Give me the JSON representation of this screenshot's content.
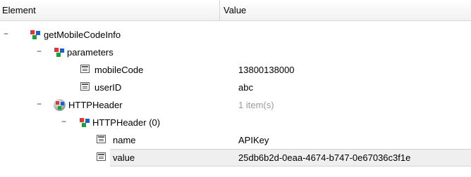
{
  "header": {
    "element": "Element",
    "value": "Value"
  },
  "tree": {
    "root": {
      "label": "getMobileCodeInfo",
      "toggle": "−"
    },
    "parameters": {
      "label": "parameters",
      "toggle": "−"
    },
    "mobileCode": {
      "label": "mobileCode",
      "value": "13800138000"
    },
    "userID": {
      "label": "userID",
      "value": "abc"
    },
    "httpHeader": {
      "label": "HTTPHeader",
      "value": "1 item(s)",
      "toggle": "−"
    },
    "httpHeader0": {
      "label": "HTTPHeader (0)",
      "toggle": "−"
    },
    "name": {
      "label": "name",
      "value": "APIKey"
    },
    "value": {
      "label": "value",
      "value": "25db6b2d-0eaa-4674-b747-0e67036c3f1e"
    }
  },
  "icons": {
    "tree_node": "tree-node-icon",
    "http_header": "http-header-icon",
    "field": "field-icon"
  },
  "colors": {
    "red": "#e8322b",
    "blue": "#1f5fd4",
    "green": "#19a23b",
    "selected_row": "#efefef",
    "dim_text": "#9a9a9a"
  }
}
